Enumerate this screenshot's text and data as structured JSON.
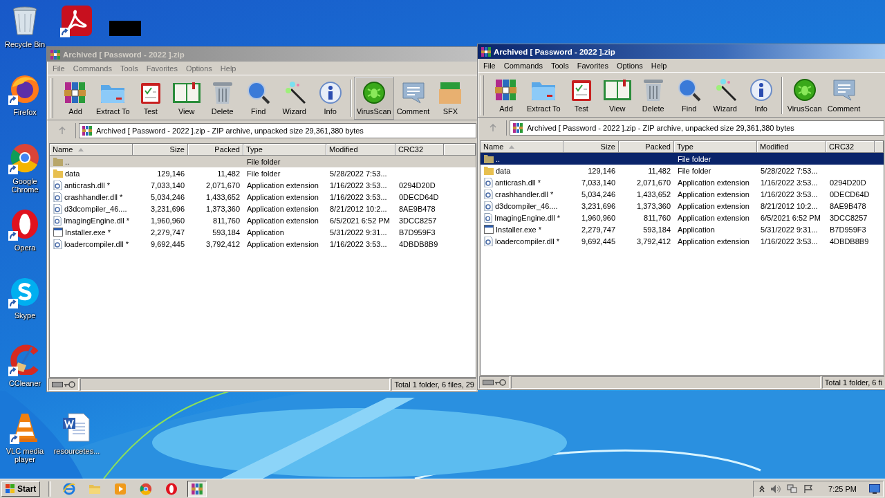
{
  "desktop_icons": [
    {
      "kind": "recycle",
      "label": "Recycle Bin",
      "shortcut": false
    },
    {
      "kind": "acrobat",
      "shortcut": true
    },
    {
      "kind": "blank",
      "shortcut": false
    },
    {
      "kind": "firefox",
      "label": "Firefox",
      "shortcut": true
    },
    {
      "kind": "chrome",
      "label": "Google Chrome",
      "shortcut": true
    },
    {
      "kind": "opera",
      "label": "Opera",
      "shortcut": true
    },
    {
      "kind": "skype",
      "label": "Skype",
      "shortcut": true
    },
    {
      "kind": "ccleaner",
      "label": "CCleaner",
      "shortcut": true
    },
    {
      "kind": "vlc",
      "label": "VLC media player",
      "shortcut": true
    },
    {
      "kind": "word",
      "label": "resourcetes...",
      "shortcut": false
    }
  ],
  "windows": [
    {
      "title": "Archived [ Password - 2022 ].zip",
      "active": false,
      "menu": [
        "File",
        "Commands",
        "Tools",
        "Favorites",
        "Options",
        "Help"
      ],
      "toolbar": [
        {
          "kind": "add",
          "label": "Add",
          "pressed": false
        },
        {
          "kind": "extract",
          "label": "Extract To",
          "pressed": false
        },
        {
          "kind": "test",
          "label": "Test",
          "pressed": false
        },
        {
          "kind": "view",
          "label": "View",
          "pressed": false
        },
        {
          "kind": "delete",
          "label": "Delete",
          "pressed": false
        },
        {
          "kind": "find",
          "label": "Find",
          "pressed": false
        },
        {
          "kind": "wizard",
          "label": "Wizard",
          "pressed": false
        },
        {
          "kind": "info",
          "label": "Info",
          "pressed": false
        },
        {
          "kind": "virusscan",
          "label": "VirusScan",
          "pressed": true
        },
        {
          "kind": "comment",
          "label": "Comment",
          "pressed": false
        },
        {
          "kind": "sfx",
          "label": "SFX",
          "pressed": false
        }
      ],
      "address": "Archived [ Password - 2022 ].zip - ZIP archive, unpacked size 29,361,380 bytes",
      "columns": [
        "Name",
        "Size",
        "Packed",
        "Type",
        "Modified",
        "CRC32"
      ],
      "rows": [
        {
          "kind": "up",
          "name": "..",
          "size": "",
          "packed": "",
          "type": "File folder",
          "modified": "",
          "crc": "",
          "selected": true
        },
        {
          "kind": "folder",
          "name": "data",
          "size": "129,146",
          "packed": "11,482",
          "type": "File folder",
          "modified": "5/28/2022 7:53...",
          "crc": "",
          "selected": false
        },
        {
          "kind": "dll",
          "name": "anticrash.dll *",
          "size": "7,033,140",
          "packed": "2,071,670",
          "type": "Application extension",
          "modified": "1/16/2022 3:53...",
          "crc": "0294D20D",
          "selected": false
        },
        {
          "kind": "dll",
          "name": "crashhandler.dll *",
          "size": "5,034,246",
          "packed": "1,433,652",
          "type": "Application extension",
          "modified": "1/16/2022 3:53...",
          "crc": "0DECD64D",
          "selected": false
        },
        {
          "kind": "dll",
          "name": "d3dcompiler_46....",
          "size": "3,231,696",
          "packed": "1,373,360",
          "type": "Application extension",
          "modified": "8/21/2012 10:2...",
          "crc": "8AE9B478",
          "selected": false
        },
        {
          "kind": "dll",
          "name": "ImagingEngine.dll *",
          "size": "1,960,960",
          "packed": "811,760",
          "type": "Application extension",
          "modified": "6/5/2021 6:52 PM",
          "crc": "3DCC8257",
          "selected": false
        },
        {
          "kind": "exe",
          "name": "Installer.exe *",
          "size": "2,279,747",
          "packed": "593,184",
          "type": "Application",
          "modified": "5/31/2022 9:31...",
          "crc": "B7D959F3",
          "selected": false
        },
        {
          "kind": "dll",
          "name": "loadercompiler.dll *",
          "size": "9,692,445",
          "packed": "3,792,412",
          "type": "Application extension",
          "modified": "1/16/2022 3:53...",
          "crc": "4DBDB8B9",
          "selected": false
        }
      ],
      "status": "Total 1 folder, 6 files, 29"
    },
    {
      "title": "Archived [ Password - 2022 ].zip",
      "active": true,
      "menu": [
        "File",
        "Commands",
        "Tools",
        "Favorites",
        "Options",
        "Help"
      ],
      "toolbar": [
        {
          "kind": "add",
          "label": "Add",
          "pressed": false
        },
        {
          "kind": "extract",
          "label": "Extract To",
          "pressed": false
        },
        {
          "kind": "test",
          "label": "Test",
          "pressed": false
        },
        {
          "kind": "view",
          "label": "View",
          "pressed": false
        },
        {
          "kind": "delete",
          "label": "Delete",
          "pressed": false
        },
        {
          "kind": "find",
          "label": "Find",
          "pressed": false
        },
        {
          "kind": "wizard",
          "label": "Wizard",
          "pressed": false
        },
        {
          "kind": "info",
          "label": "Info",
          "pressed": false
        },
        {
          "kind": "virusscan",
          "label": "VirusScan",
          "pressed": false
        },
        {
          "kind": "comment",
          "label": "Comment",
          "pressed": false
        }
      ],
      "address": "Archived [ Password - 2022 ].zip - ZIP archive, unpacked size 29,361,380 bytes",
      "columns": [
        "Name",
        "Size",
        "Packed",
        "Type",
        "Modified",
        "CRC32"
      ],
      "rows": [
        {
          "kind": "up",
          "name": "..",
          "size": "",
          "packed": "",
          "type": "File folder",
          "modified": "",
          "crc": "",
          "selected": true
        },
        {
          "kind": "folder",
          "name": "data",
          "size": "129,146",
          "packed": "11,482",
          "type": "File folder",
          "modified": "5/28/2022 7:53...",
          "crc": "",
          "selected": false
        },
        {
          "kind": "dll",
          "name": "anticrash.dll *",
          "size": "7,033,140",
          "packed": "2,071,670",
          "type": "Application extension",
          "modified": "1/16/2022 3:53...",
          "crc": "0294D20D",
          "selected": false
        },
        {
          "kind": "dll",
          "name": "crashhandler.dll *",
          "size": "5,034,246",
          "packed": "1,433,652",
          "type": "Application extension",
          "modified": "1/16/2022 3:53...",
          "crc": "0DECD64D",
          "selected": false
        },
        {
          "kind": "dll",
          "name": "d3dcompiler_46....",
          "size": "3,231,696",
          "packed": "1,373,360",
          "type": "Application extension",
          "modified": "8/21/2012 10:2...",
          "crc": "8AE9B478",
          "selected": false
        },
        {
          "kind": "dll",
          "name": "ImagingEngine.dll *",
          "size": "1,960,960",
          "packed": "811,760",
          "type": "Application extension",
          "modified": "6/5/2021 6:52 PM",
          "crc": "3DCC8257",
          "selected": false
        },
        {
          "kind": "exe",
          "name": "Installer.exe *",
          "size": "2,279,747",
          "packed": "593,184",
          "type": "Application",
          "modified": "5/31/2022 9:31...",
          "crc": "B7D959F3",
          "selected": false
        },
        {
          "kind": "dll",
          "name": "loadercompiler.dll *",
          "size": "9,692,445",
          "packed": "3,792,412",
          "type": "Application extension",
          "modified": "1/16/2022 3:53...",
          "crc": "4DBDB8B9",
          "selected": false
        }
      ],
      "status": "Total 1 folder, 6 fi"
    }
  ],
  "taskbar": {
    "start": "Start",
    "items": [
      {
        "kind": "ie",
        "selected": false
      },
      {
        "kind": "explorer",
        "selected": false
      },
      {
        "kind": "media",
        "selected": false
      },
      {
        "kind": "chrome",
        "selected": false
      },
      {
        "kind": "opera",
        "selected": false
      },
      {
        "kind": "winrar",
        "selected": true
      }
    ],
    "clock": "7:25 PM"
  }
}
